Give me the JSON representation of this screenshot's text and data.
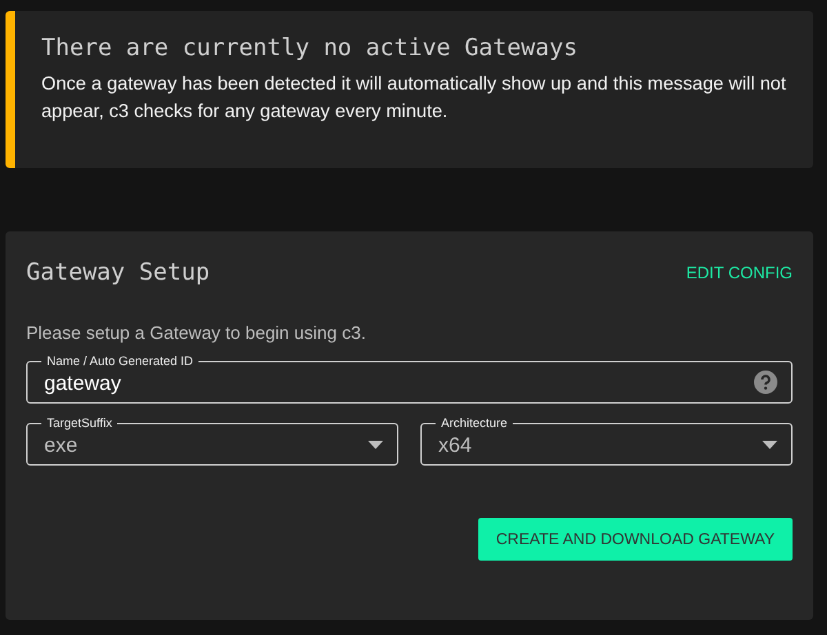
{
  "alert": {
    "title": "There are currently no active Gateways",
    "message": "Once a gateway has been detected it will automatically show up and this message will not appear, c3 checks for any gateway every minute."
  },
  "setup": {
    "title": "Gateway Setup",
    "edit_link": "EDIT CONFIG",
    "intro": "Please setup a Gateway to begin using c3.",
    "fields": [
      {
        "kind": "text",
        "label": "Name / Auto Generated ID",
        "value": "gateway"
      },
      {
        "kind": "select",
        "label": "TargetSuffix",
        "value": "exe"
      },
      {
        "kind": "select",
        "label": "Architecture",
        "value": "x64"
      }
    ],
    "button": "CREATE AND DOWNLOAD GATEWAY"
  }
}
